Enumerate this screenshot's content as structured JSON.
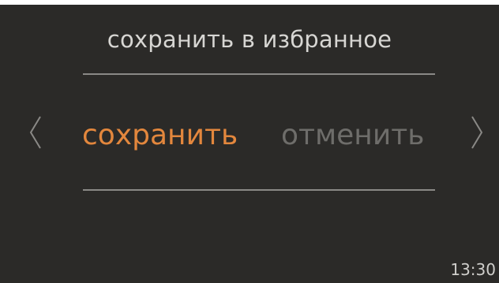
{
  "dialog": {
    "title": "сохранить в избранное"
  },
  "options": {
    "save_label": "сохранить",
    "cancel_label": "отменить",
    "selected": "сохранить"
  },
  "navigation": {
    "prev_icon": "chevron-left-icon",
    "next_icon": "chevron-right-icon"
  },
  "status": {
    "time": "13:30"
  },
  "colors": {
    "background": "#2b2a28",
    "accent": "#e3873d",
    "inactive": "#6e6d6a",
    "text": "#d7d6d3",
    "divider": "#8a8986"
  }
}
